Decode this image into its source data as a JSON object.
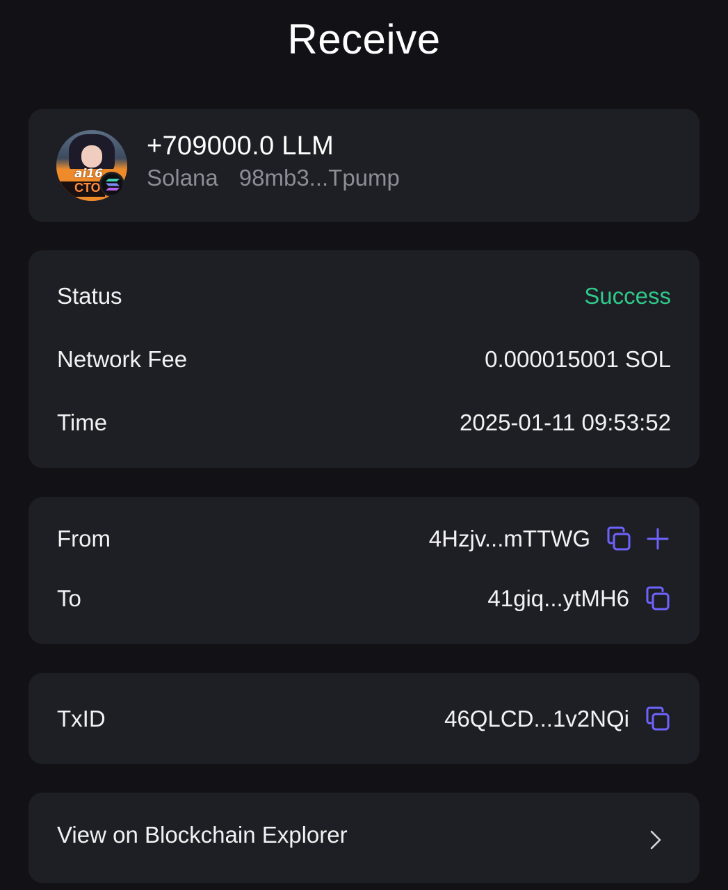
{
  "page": {
    "title": "Receive"
  },
  "token": {
    "amount": "+709000.0 LLM",
    "network": "Solana",
    "contract": "98mb3...Tpump",
    "avatar_text_top": "ai16",
    "avatar_text_bottom": "CTO",
    "network_badge_icon": "solana-icon"
  },
  "details": {
    "status_label": "Status",
    "status_value": "Success",
    "fee_label": "Network Fee",
    "fee_value": "0.000015001 SOL",
    "time_label": "Time",
    "time_value": "2025-01-11 09:53:52"
  },
  "addresses": {
    "from_label": "From",
    "from_value": "4Hzjv...mTTWG",
    "to_label": "To",
    "to_value": "41giq...ytMH6"
  },
  "txid": {
    "label": "TxID",
    "value": "46QLCD...1v2NQi"
  },
  "explorer": {
    "label": "View on Blockchain Explorer"
  },
  "colors": {
    "background": "#121216",
    "card": "#1e1f24",
    "success": "#2fc98a",
    "accent_icon": "#6f63ff",
    "muted_text": "#8c8d96"
  },
  "icons": {
    "copy": "copy-icon",
    "add": "plus-icon",
    "chevron": "chevron-right-icon"
  }
}
